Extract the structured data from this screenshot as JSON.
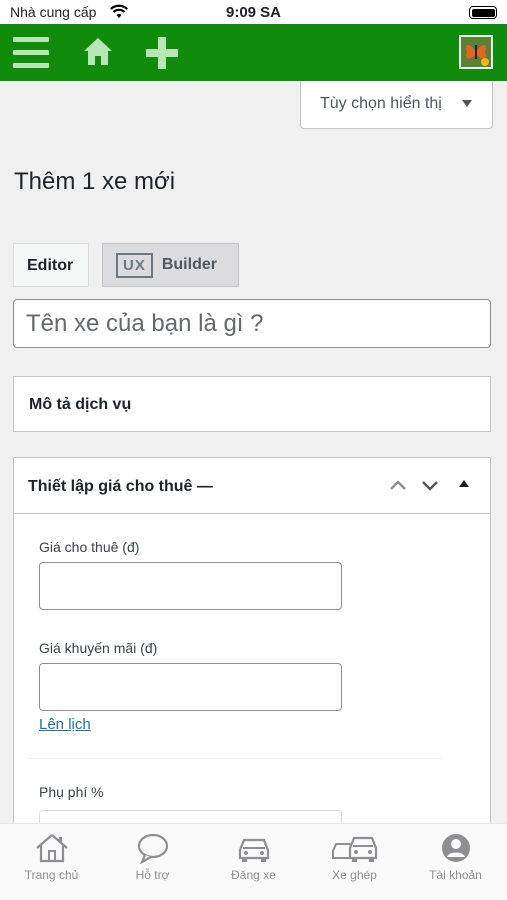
{
  "status_bar": {
    "carrier": "Nhà cung cấp",
    "time": "9:09 SA"
  },
  "admin_bar": {
    "icons": [
      "menu-icon",
      "home-icon",
      "plus-icon",
      "avatar"
    ],
    "color": "#118b0c"
  },
  "screen_options": {
    "label": "Tùy chọn hiển thị"
  },
  "page": {
    "title": "Thêm 1 xe mới"
  },
  "editor_tabs": {
    "editor": "Editor",
    "ux_badge": "UX",
    "ux_label": "Builder"
  },
  "title_field": {
    "placeholder": "Tên xe của bạn là gì ?"
  },
  "description_box": {
    "title": "Mô tả dịch vụ"
  },
  "price_box": {
    "title": "Thiết lập giá cho thuê —",
    "rent_price_label": "Giá cho thuê (đ)",
    "sale_price_label": "Giá khuyến mãi (đ)",
    "schedule_link": "Lên lịch",
    "surcharge_label": "Phụ phí %"
  },
  "tab_bar": {
    "items": [
      {
        "label": "Trang chủ",
        "icon": "house-icon"
      },
      {
        "label": "Hỗ trợ",
        "icon": "chat-bubble-icon"
      },
      {
        "label": "Đăng xe",
        "icon": "car-icon"
      },
      {
        "label": "Xe ghép",
        "icon": "cars-icon"
      },
      {
        "label": "Tài khoản",
        "icon": "account-icon"
      }
    ]
  }
}
